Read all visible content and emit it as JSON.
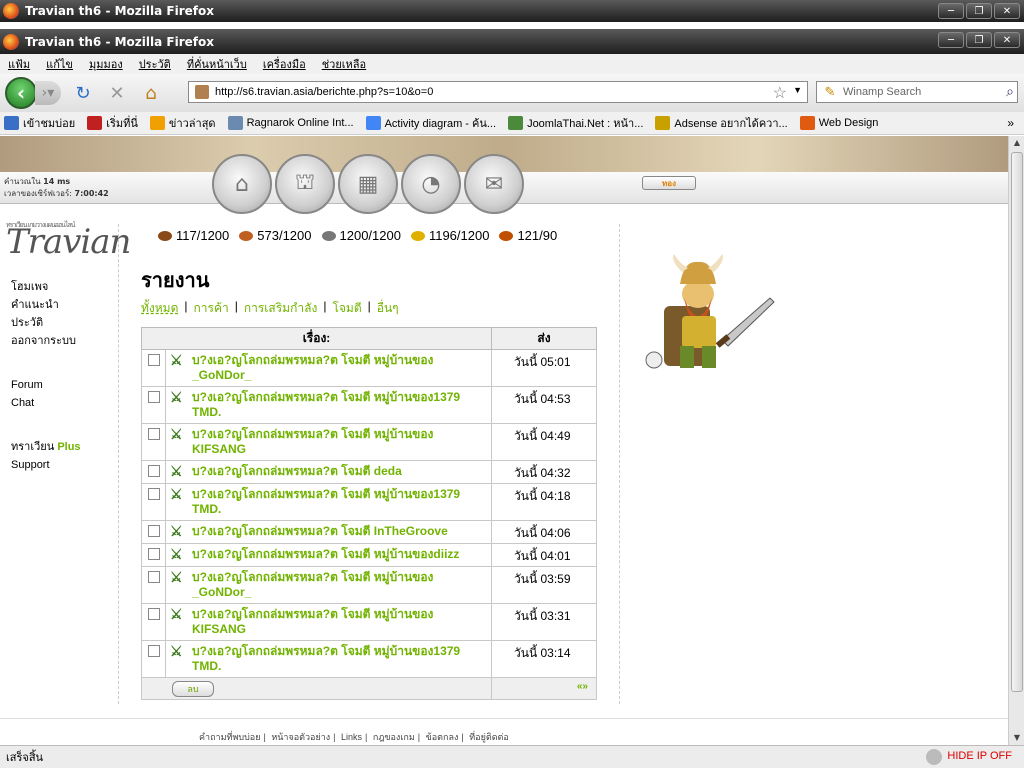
{
  "window": {
    "back_title": "Travian th6 - Mozilla Firefox",
    "front_title": "Travian th6 - Mozilla Firefox"
  },
  "menu": [
    "แฟ้ม",
    "แก้ไข",
    "มุมมอง",
    "ประวัติ",
    "ที่คั่นหน้าเว็บ",
    "เครื่องมือ",
    "ช่วยเหลือ"
  ],
  "nav": {
    "url": "http://s6.travian.asia/berichte.php?s=10&o=0",
    "search_placeholder": "Winamp Search"
  },
  "bookmarks": [
    {
      "label": "เข้าชมบ่อย",
      "color": "#3a6fc8"
    },
    {
      "label": "เริ่มที่นี่",
      "color": "#c02020"
    },
    {
      "label": "ข่าวล่าสุด",
      "color": "#f0a000"
    },
    {
      "label": "Ragnarok Online Int...",
      "color": "#6a8ab0"
    },
    {
      "label": "Activity diagram - ค้น...",
      "color": "#4285f4"
    },
    {
      "label": "JoomlaThai.Net : หน้า...",
      "color": "#4a8a3a"
    },
    {
      "label": "Adsense อยากได้ควา...",
      "color": "#c8a000"
    },
    {
      "label": "Web Design",
      "color": "#e05a10"
    }
  ],
  "game": {
    "calc_label": "คำนวณใน",
    "calc_value": "14 ms",
    "server_time_label": "เวลาของเซิร์ฟเวอร์:",
    "server_time": "7:00:42",
    "gold_button": "ทอง",
    "logo_text": "Travian",
    "logo_caption": "ทราเวียน เกมวางแผนออนไลน์",
    "sidebar": {
      "home": "โฮมเพจ",
      "instructions": "คำแนะนำ",
      "profile": "ประวัติ",
      "logout": "ออกจากระบบ",
      "forum": "Forum",
      "chat": "Chat",
      "plus_prefix": "ทราเวียน",
      "plus": "Plus",
      "support": "Support"
    },
    "resources": [
      {
        "name": "wood",
        "value": "117/1200",
        "color": "#8a4a18"
      },
      {
        "name": "clay",
        "value": "573/1200",
        "color": "#c06020"
      },
      {
        "name": "iron",
        "value": "1200/1200",
        "color": "#777777"
      },
      {
        "name": "crop",
        "value": "1196/1200",
        "color": "#e0b000"
      },
      {
        "name": "consumption",
        "value": "121/90",
        "color": "#c05000"
      }
    ],
    "title": "รายงาน",
    "filters": [
      "ทั้งหมด",
      "การค้า",
      "การเสริมกำลัง",
      "โจมตี",
      "อื่นๆ"
    ],
    "table": {
      "col_subject": "เรื่อง:",
      "col_sent": "ส่ง",
      "rows": [
        {
          "subject": "บ?งเอ?ญโลกถล่มพรหมล?ต โจมตี หมู่บ้านของ _GoNDor_",
          "time": "วันนี้ 05:01"
        },
        {
          "subject": "บ?งเอ?ญโลกถล่มพรหมล?ต โจมตี หมู่บ้านของ1379 TMD.",
          "time": "วันนี้ 04:53"
        },
        {
          "subject": "บ?งเอ?ญโลกถล่มพรหมล?ต โจมตี หมู่บ้านของ KIFSANG",
          "time": "วันนี้ 04:49"
        },
        {
          "subject": "บ?งเอ?ญโลกถล่มพรหมล?ต โจมตี deda",
          "time": "วันนี้ 04:32"
        },
        {
          "subject": "บ?งเอ?ญโลกถล่มพรหมล?ต โจมตี หมู่บ้านของ1379 TMD.",
          "time": "วันนี้ 04:18"
        },
        {
          "subject": "บ?งเอ?ญโลกถล่มพรหมล?ต โจมตี InTheGroove",
          "time": "วันนี้ 04:06"
        },
        {
          "subject": "บ?งเอ?ญโลกถล่มพรหมล?ต โจมตี หมู่บ้านของdiizz",
          "time": "วันนี้ 04:01"
        },
        {
          "subject": "บ?งเอ?ญโลกถล่มพรหมล?ต โจมตี หมู่บ้านของ _GoNDor_",
          "time": "วันนี้ 03:59"
        },
        {
          "subject": "บ?งเอ?ญโลกถล่มพรหมล?ต โจมตี หมู่บ้านของ KIFSANG",
          "time": "วันนี้ 03:31"
        },
        {
          "subject": "บ?งเอ?ญโลกถล่มพรหมล?ต โจมตี หมู่บ้านของ1379 TMD.",
          "time": "วันนี้ 03:14"
        }
      ],
      "delete_button": "ลบ",
      "pager": "«»"
    },
    "footer_links": [
      "คำถามที่พบบ่อย",
      "หน้าจอตัวอย่าง",
      "Links",
      "กฎของเกม",
      "ข้อตกลง",
      "ที่อยู่ติดต่อ"
    ]
  },
  "status": {
    "text": "เสร็จสิ้น",
    "hide_ip": "HIDE IP OFF"
  }
}
